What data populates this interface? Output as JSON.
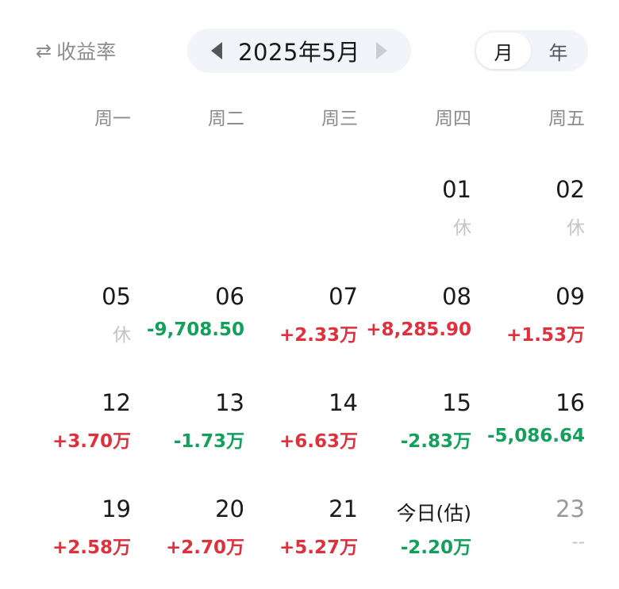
{
  "header": {
    "toggle_label": "收益率",
    "toggle_icon": "⇄",
    "month_label": "2025年5月",
    "view_options": [
      "月",
      "年"
    ],
    "active_view": 0
  },
  "weekdays": [
    "周一",
    "周二",
    "周三",
    "周四",
    "周五"
  ],
  "colors": {
    "up": "#e0303c",
    "down": "#14a05a",
    "rest": "#c4c4c4"
  },
  "calendar": {
    "weeks": [
      [
        null,
        null,
        null,
        {
          "day": "01",
          "value": "休",
          "kind": "rest"
        },
        {
          "day": "02",
          "value": "休",
          "kind": "rest"
        }
      ],
      [
        {
          "day": "05",
          "value": "休",
          "kind": "rest"
        },
        {
          "day": "06",
          "value": "-9,708.50",
          "kind": "down"
        },
        {
          "day": "07",
          "value": "+2.33万",
          "kind": "up"
        },
        {
          "day": "08",
          "value": "+8,285.90",
          "kind": "up"
        },
        {
          "day": "09",
          "value": "+1.53万",
          "kind": "up"
        }
      ],
      [
        {
          "day": "12",
          "value": "+3.70万",
          "kind": "up"
        },
        {
          "day": "13",
          "value": "-1.73万",
          "kind": "down"
        },
        {
          "day": "14",
          "value": "+6.63万",
          "kind": "up"
        },
        {
          "day": "15",
          "value": "-2.83万",
          "kind": "down"
        },
        {
          "day": "16",
          "value": "-5,086.64",
          "kind": "down"
        }
      ],
      [
        {
          "day": "19",
          "value": "+2.58万",
          "kind": "up"
        },
        {
          "day": "20",
          "value": "+2.70万",
          "kind": "up"
        },
        {
          "day": "21",
          "value": "+5.27万",
          "kind": "up"
        },
        {
          "day": "今日(估)",
          "value": "-2.20万",
          "kind": "down",
          "today": true
        },
        {
          "day": "23",
          "value": "--",
          "kind": "none",
          "muted": true
        }
      ]
    ]
  }
}
